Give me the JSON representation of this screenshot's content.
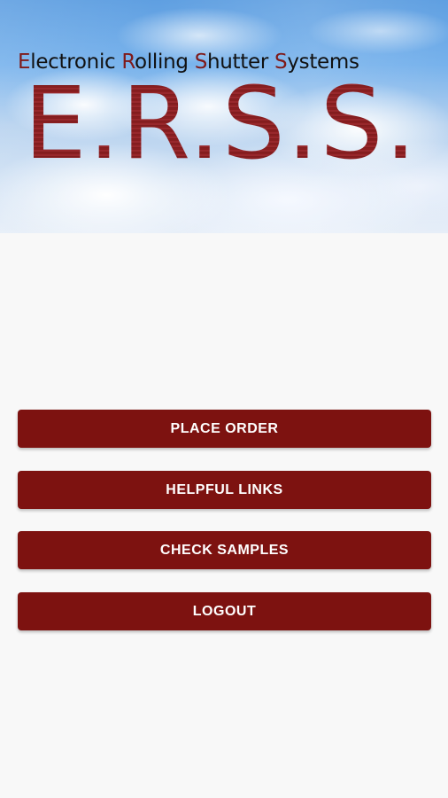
{
  "header": {
    "subtitle_parts": [
      "E",
      "lectronic ",
      "R",
      "olling ",
      "S",
      "hutter ",
      "S",
      "ystems"
    ],
    "title": "E.R.S.S."
  },
  "buttons": {
    "place_order": "PLACE ORDER",
    "helpful_links": "HELPFUL LINKS",
    "check_samples": "CHECK SAMPLES",
    "logout": "LOGOUT"
  },
  "colors": {
    "banner_title": "#8e2225",
    "button_background": "#7d1210",
    "button_text": "#ffffff",
    "page_background": "#f8f8f8"
  }
}
